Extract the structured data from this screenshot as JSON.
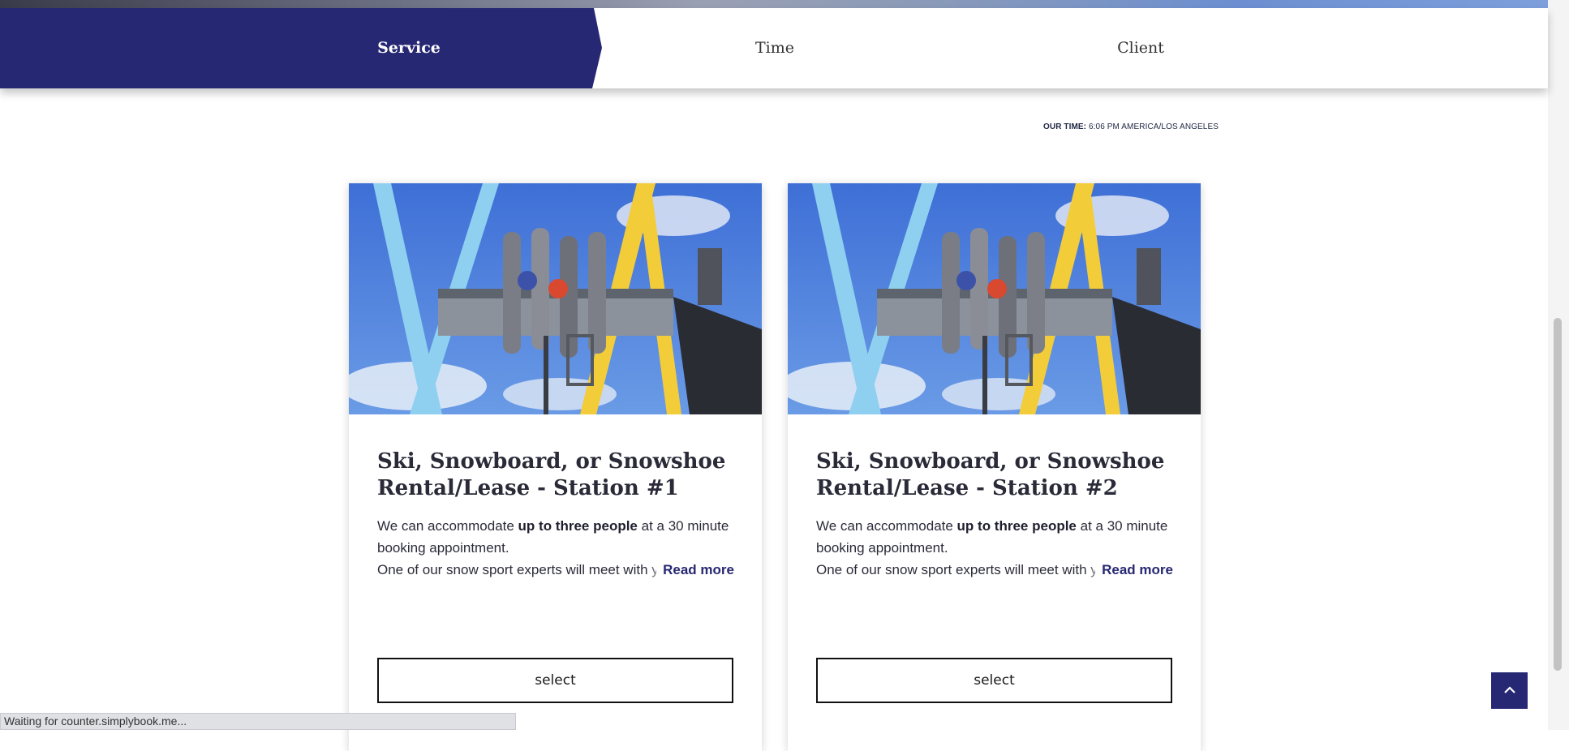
{
  "steps": {
    "service": "Service",
    "time": "Time",
    "client": "Client"
  },
  "our_time": {
    "label": "OUR TIME:",
    "value": "6:06 PM AMERICA/LOS ANGELES"
  },
  "cards": [
    {
      "title": "Ski, Snowboard, or Snowshoe Rental/Lease - Station #1",
      "desc_pre": "We can accommodate ",
      "desc_bold": "up to three people",
      "desc_post": " at a 30 minute booking appointment.",
      "desc_more": "One of our snow sport experts will meet with you and",
      "read_more": "Read more",
      "select": "select"
    },
    {
      "title": "Ski, Snowboard, or Snowshoe Rental/Lease - Station #2",
      "desc_pre": "We can accommodate ",
      "desc_bold": "up to three people",
      "desc_post": " at a 30 minute booking appointment.",
      "desc_more": "One of our snow sport experts will meet with you and",
      "read_more": "Read more",
      "select": "select"
    }
  ],
  "status_bar": "Waiting for counter.simplybook.me...",
  "icons": {
    "scroll_top": "chevron-up-icon"
  },
  "colors": {
    "accent": "#272873",
    "white": "#ffffff"
  }
}
